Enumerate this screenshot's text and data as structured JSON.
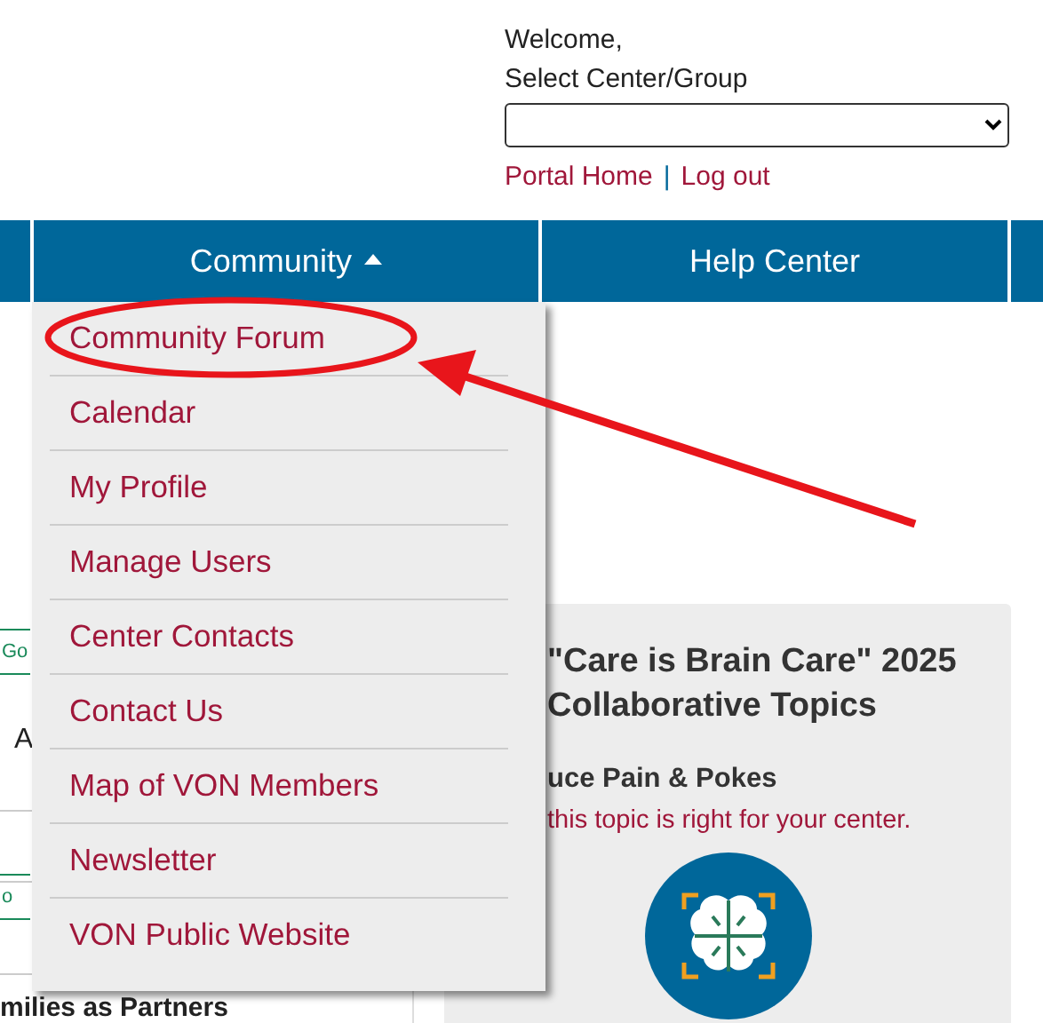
{
  "header": {
    "welcome": "Welcome,",
    "select_label": "Select Center/Group",
    "links": [
      "Portal Home",
      "Log out"
    ],
    "separator": "|"
  },
  "nav": [
    {
      "label": "Community",
      "expanded": true
    },
    {
      "label": "Help Center",
      "expanded": false
    }
  ],
  "menu": [
    {
      "label": "Community Forum",
      "highlighted": true
    },
    {
      "label": "Calendar",
      "highlighted": false
    },
    {
      "label": "My Profile",
      "highlighted": false
    },
    {
      "label": "Manage Users",
      "highlighted": false
    },
    {
      "label": "Center Contacts",
      "highlighted": false
    },
    {
      "label": "Contact Us",
      "highlighted": false
    },
    {
      "label": "Map of VON Members",
      "highlighted": false
    },
    {
      "label": "Newsletter",
      "highlighted": false
    },
    {
      "label": "VON Public Website",
      "highlighted": false
    }
  ],
  "left_column": {
    "links": [
      "Go",
      "o"
    ],
    "text": "A",
    "heading": "milies as Partners"
  },
  "panel": {
    "title_lines": [
      "\"Care is Brain Care\" 2025",
      "Collaborative Topics"
    ],
    "subtitle": "uce Pain & Pokes",
    "note": "this topic is right for your center."
  }
}
